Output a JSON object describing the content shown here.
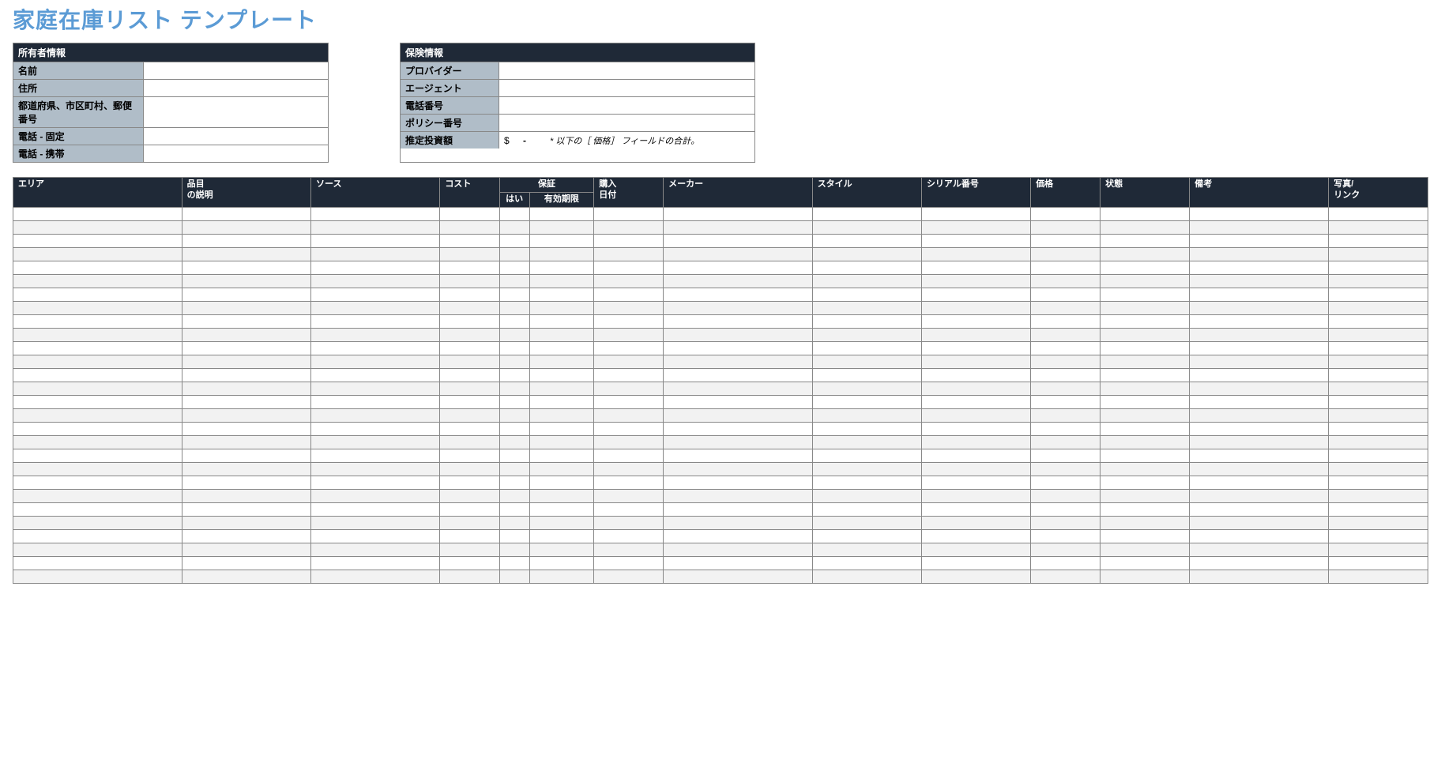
{
  "title": "家庭在庫リスト テンプレート",
  "owner": {
    "header": "所有者情報",
    "rows": [
      {
        "label": "名前",
        "value": ""
      },
      {
        "label": "住所",
        "value": ""
      },
      {
        "label": "都道府県、市区町村、郵便番号",
        "value": ""
      },
      {
        "label": "電話 - 固定",
        "value": ""
      },
      {
        "label": "電話 - 携帯",
        "value": ""
      }
    ]
  },
  "insurance": {
    "header": "保険情報",
    "rows": [
      {
        "label": "プロバイダー",
        "value": ""
      },
      {
        "label": "エージェント",
        "value": ""
      },
      {
        "label": "電話番号",
        "value": ""
      },
      {
        "label": "ポリシー番号",
        "value": ""
      }
    ],
    "estimate_label": "推定投資額",
    "estimate_currency": "$",
    "estimate_dash": "-",
    "estimate_note": "* 以下の［ 価格］ フィールドの合計。"
  },
  "grid": {
    "headers": {
      "area": "エリア",
      "item_l1": "品目",
      "item_l2": "の説明",
      "source": "ソース",
      "cost": "コスト",
      "warranty": "保証",
      "warranty_yes": "はい",
      "warranty_exp": "有効期限",
      "purchase_l1": "購入",
      "purchase_l2": "日付",
      "maker": "メーカー",
      "style": "スタイル",
      "serial": "シリアル番号",
      "price": "価格",
      "condition": "状態",
      "notes": "備考",
      "photo_l1": "写真/",
      "photo_l2": "リンク"
    },
    "row_count": 28
  }
}
